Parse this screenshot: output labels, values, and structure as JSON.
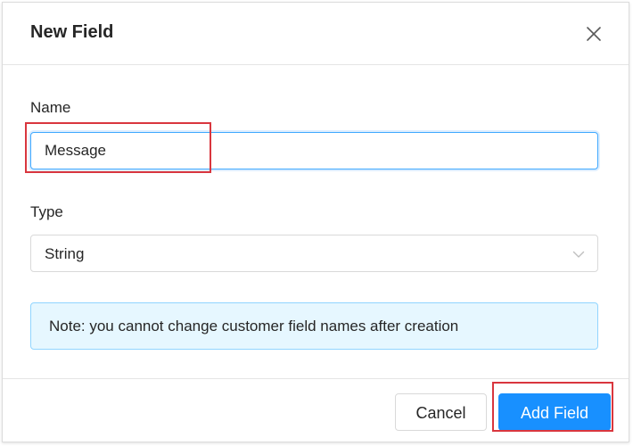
{
  "dialog": {
    "title": "New Field",
    "close_icon": "close-icon"
  },
  "form": {
    "name_label": "Name",
    "name_value": "Message",
    "type_label": "Type",
    "type_value": "String",
    "type_icon": "chevron-down-icon"
  },
  "note": {
    "text": "Note: you cannot change customer field names after creation"
  },
  "footer": {
    "cancel_label": "Cancel",
    "add_label": "Add Field"
  },
  "colors": {
    "primary": "#1890ff",
    "note_background": "#e6f7ff",
    "note_border": "#91d5ff",
    "highlight": "#d9363e"
  }
}
